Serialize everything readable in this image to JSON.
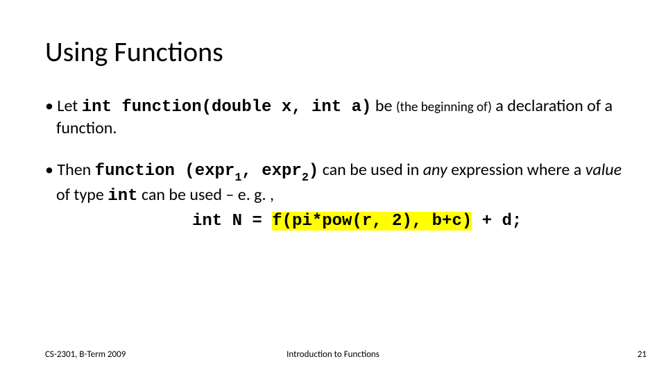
{
  "title": "Using Functions",
  "bullet1": {
    "t_let": "Let ",
    "code_decl": "int function(double x, int a)",
    "t_be": " be ",
    "t_paren": "(the beginning of)",
    "t_rest": " a declaration of a function."
  },
  "bullet2": {
    "t_then": "Then ",
    "code_fn": "function (expr",
    "sub1": "1",
    "code_comma": ", expr",
    "sub2": "2",
    "code_close": ")",
    "t_can": " can be used in ",
    "t_any": "any",
    "t_expr": " expression where a ",
    "t_value": "value",
    "t_oftype": " of type ",
    "code_int": "int",
    "t_eg": " can be used – e. g. ,"
  },
  "codeline": {
    "pre": "int N = ",
    "hl": "f(pi*pow(r, 2), b+c)",
    "post": " + d;"
  },
  "footer": {
    "left": "CS-2301, B-Term 2009",
    "center": "Introduction to Functions",
    "right": "21"
  }
}
